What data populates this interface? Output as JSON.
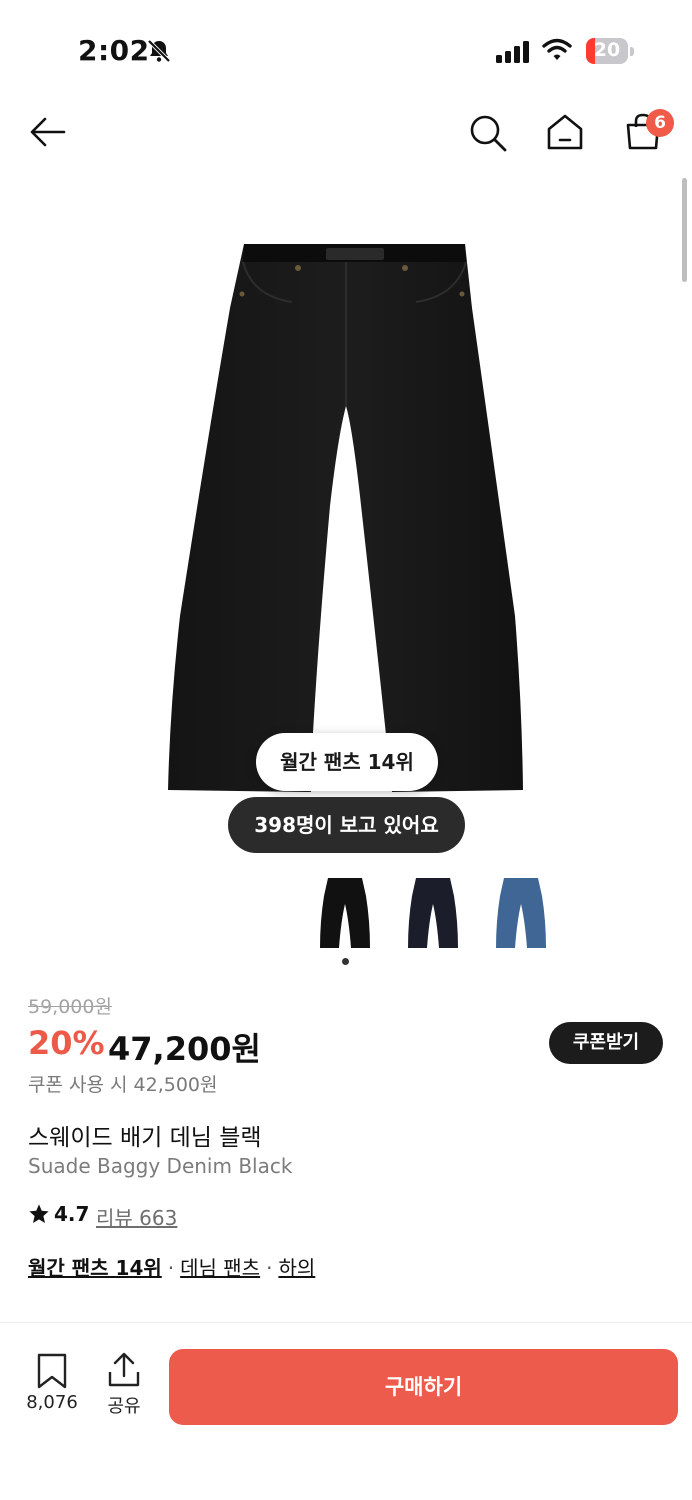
{
  "status_bar": {
    "time": "2:02",
    "battery": "20"
  },
  "header": {
    "cart_count": "6"
  },
  "product": {
    "rank_badge": "월간 팬츠 14위",
    "viewers": "398명이 보고 있어요",
    "original_price": "59,000원",
    "discount": "20%",
    "price": "47,200원",
    "coupon_button": "쿠폰받기",
    "coupon_price": "쿠폰 사용 시 42,500원",
    "name_ko": "스웨이드 배기 데님 블랙",
    "name_en": "Suade Baggy Denim Black",
    "rating": "4.7",
    "reviews": "리뷰 663",
    "categories": [
      "월간 팬츠 14위",
      "데님 팬츠",
      "하의"
    ],
    "thumbnail_colors": [
      "#111111",
      "#1b1d2a",
      "#3f6694"
    ]
  },
  "bottom_bar": {
    "bookmark_count": "8,076",
    "share_label": "공유",
    "buy_label": "구매하기"
  },
  "colors": {
    "accent": "#ed5b4c",
    "dark_pill": "#2b2b2b"
  }
}
